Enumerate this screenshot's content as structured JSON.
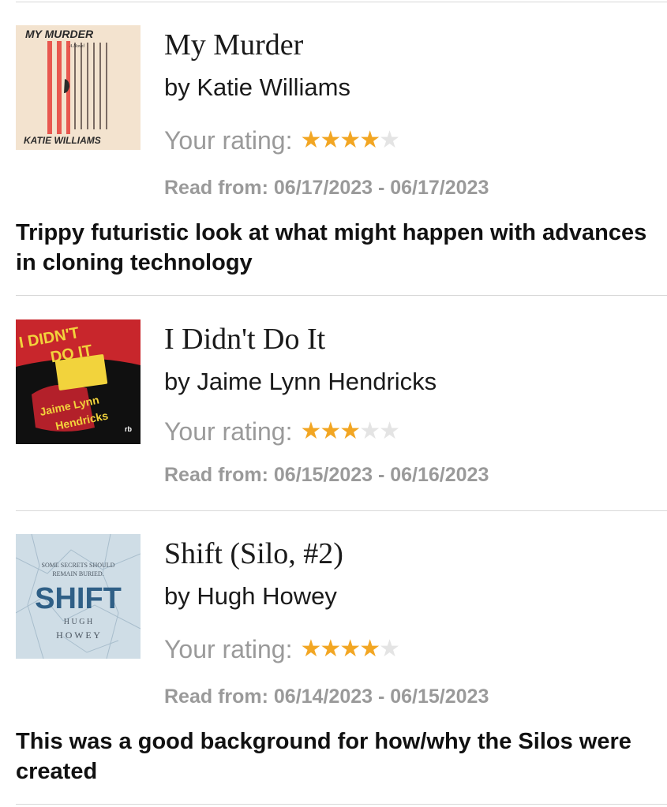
{
  "rating_label": "Your rating:",
  "colors": {
    "star_on": "#f2a623",
    "star_off": "#e4e4e4",
    "muted_text": "#9a9a9a"
  },
  "books": [
    {
      "title": "My Murder",
      "author": "by Katie Williams",
      "rating": 4,
      "rating_max": 5,
      "dates": "Read from: 06/17/2023 - 06/17/2023",
      "review": "Trippy futuristic look at what might happen with advances in cloning technology",
      "cover": {
        "title": "MY MURDER",
        "subtitle": "A Novel",
        "author": "KATIE WILLIAMS"
      }
    },
    {
      "title": "I Didn't Do It",
      "author": "by Jaime Lynn Hendricks",
      "rating": 3,
      "rating_max": 5,
      "dates": "Read from: 06/15/2023 - 06/16/2023",
      "review": "",
      "cover": {
        "title_line1": "I DIDN'T",
        "title_line2": "DO IT",
        "author_line1": "Jaime Lynn",
        "author_line2": "Hendricks",
        "publisher": "rb"
      }
    },
    {
      "title": "Shift (Silo, #2)",
      "author": "by Hugh Howey",
      "rating": 4,
      "rating_max": 5,
      "dates": "Read from: 06/14/2023 - 06/15/2023",
      "review": "This was a good background for how/why the Silos were created",
      "cover": {
        "tagline1": "SOME SECRETS SHOULD",
        "tagline2": "REMAIN BURIED.",
        "title": "SHIFT",
        "author1": "H U G H",
        "author2": "H O W E Y"
      }
    }
  ]
}
